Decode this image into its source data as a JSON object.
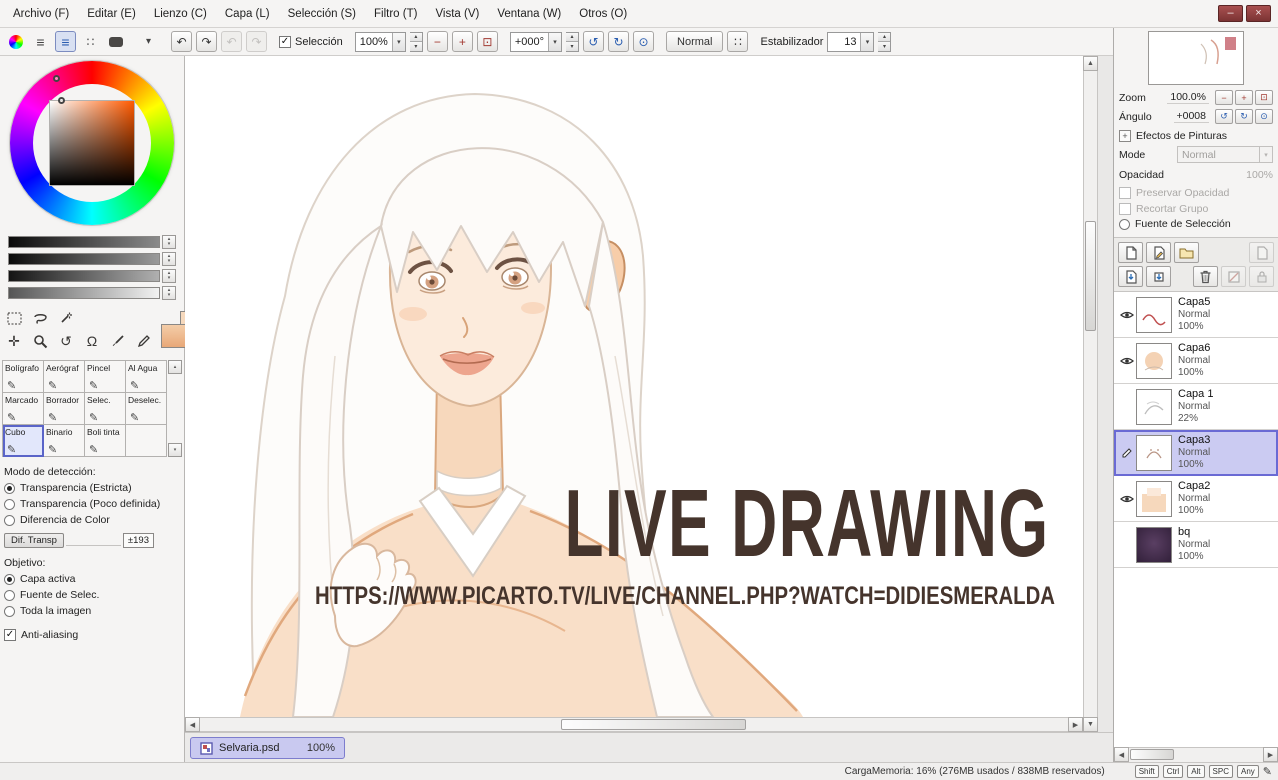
{
  "icons": {
    "minimize": "–",
    "close": "×",
    "dropdown": "▾",
    "spin_up": "▴",
    "spin_down": "▾",
    "up": "▲",
    "down": "▼",
    "left": "◀",
    "right": "▶",
    "undo": "↶",
    "redo": "↷",
    "minus": "−",
    "plus": "+",
    "zoom_reset": "⊡",
    "rotate_ccw": "↺",
    "rotate_cw": "↻",
    "rotate_reset": "⊙",
    "check": "✓",
    "swap": "⇅",
    "move": "✛",
    "hand": "Ω",
    "pencil": "✎",
    "lines": "≡",
    "dots": "∷",
    "plus_small": "+"
  },
  "menubar": {
    "items": [
      {
        "label": "Archivo (F)"
      },
      {
        "label": "Editar (E)"
      },
      {
        "label": "Lienzo (C)"
      },
      {
        "label": "Capa (L)"
      },
      {
        "label": "Selección (S)"
      },
      {
        "label": "Filtro (T)"
      },
      {
        "label": "Vista (V)"
      },
      {
        "label": "Ventana (W)"
      },
      {
        "label": "Otros (O)"
      }
    ]
  },
  "toolbar": {
    "seleccion_label": "Selección",
    "seleccion_checked": true,
    "zoom_value": "100%",
    "angle_value": "+000°",
    "normal_button": "Normal",
    "estabilizador_label": "Estabilizador",
    "estabilizador_value": "13"
  },
  "left_panel": {
    "tools": [
      "Bolígrafo",
      "Aerógraf",
      "Pincel",
      "Al Agua",
      "Marcado",
      "Borrador",
      "Selec.",
      "Deselec.",
      "Cubo",
      "Binario",
      "Boli tinta",
      ""
    ],
    "selected_tool": "Cubo",
    "detection_title": "Modo de detección:",
    "detection_options": [
      {
        "label": "Transparencia (Estricta)",
        "selected": true
      },
      {
        "label": "Transparencia (Poco definida)",
        "selected": false
      },
      {
        "label": "Diferencia de Color",
        "selected": false
      }
    ],
    "dif_transp_button": "Dif. Transp",
    "dif_transp_value": "±193",
    "objetivo_title": "Objetivo:",
    "objetivo_options": [
      {
        "label": "Capa activa",
        "selected": true
      },
      {
        "label": "Fuente de Selec.",
        "selected": false
      },
      {
        "label": "Toda la imagen",
        "selected": false
      }
    ],
    "antialiasing_label": "Anti-aliasing",
    "antialiasing_checked": true
  },
  "canvas": {
    "title_text": "LIVE DRAWING",
    "url_text": "HTTPS://WWW.PICARTO.TV/LIVE/CHANNEL.PHP?WATCH=DIDIESMERALDA"
  },
  "document_tab": {
    "name": "Selvaria.psd",
    "zoom": "100%"
  },
  "right_panel": {
    "zoom_label": "Zoom",
    "zoom_value": "100.0%",
    "angle_label": "Ángulo",
    "angle_value": "+0008",
    "efectos_title": "Efectos de Pinturas",
    "mode_label": "Mode",
    "mode_value": "Normal",
    "opacity_label": "Opacidad",
    "opacity_value": "100%",
    "preservar_label": "Preservar Opacidad",
    "recortar_label": "Recortar Grupo",
    "fuente_label": "Fuente de Selección",
    "layers": [
      {
        "name": "Capa5",
        "mode": "Normal",
        "opacity": "100%",
        "visible": true,
        "selected": false
      },
      {
        "name": "Capa6",
        "mode": "Normal",
        "opacity": "100%",
        "visible": true,
        "selected": false
      },
      {
        "name": "Capa 1",
        "mode": "Normal",
        "opacity": "22%",
        "visible": false,
        "selected": false
      },
      {
        "name": "Capa3",
        "mode": "Normal",
        "opacity": "100%",
        "visible": false,
        "selected": true,
        "editing": true
      },
      {
        "name": "Capa2",
        "mode": "Normal",
        "opacity": "100%",
        "visible": true,
        "selected": false
      },
      {
        "name": "bq",
        "mode": "Normal",
        "opacity": "100%",
        "visible": false,
        "selected": false
      }
    ]
  },
  "statusbar": {
    "memory_text": "CargaMemoria: 16% (276MB usados / 838MB reservados)",
    "keys": [
      "Shift",
      "Ctrl",
      "Alt",
      "SPC"
    ],
    "any_label": "Any"
  },
  "colors": {
    "accent_selection": "#cbcbf2",
    "accent_border": "#6a6ad4",
    "current_hue": "#ff5a00",
    "primary_color": "#f0bd95",
    "title_ink": "#45342c"
  }
}
